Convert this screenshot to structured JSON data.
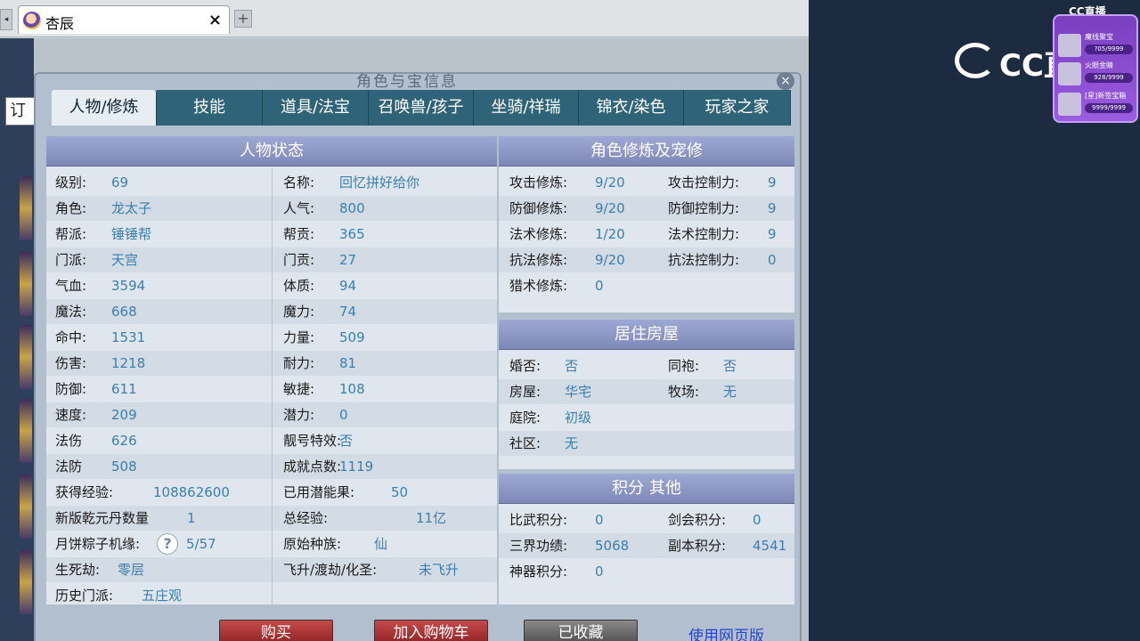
{
  "browser": {
    "tab_title": "杏辰",
    "tab_close": "×",
    "new_tab": "+",
    "page_left_box": "订",
    "scroll_left": "◂"
  },
  "dialog": {
    "title": "角色与宝信息",
    "close": "×",
    "tabs": [
      "人物/修炼",
      "技能",
      "道具/法宝",
      "召唤兽/孩子",
      "坐骑/祥瑞",
      "锦衣/染色",
      "玩家之家"
    ],
    "status": {
      "header": "人物状态",
      "left": [
        {
          "label": "级别:",
          "value": "69"
        },
        {
          "label": "角色:",
          "value": "龙太子"
        },
        {
          "label": "帮派:",
          "value": "锤锤帮"
        },
        {
          "label": "门派:",
          "value": "天宫"
        },
        {
          "label": "气血:",
          "value": "3594"
        },
        {
          "label": "魔法:",
          "value": "668"
        },
        {
          "label": "命中:",
          "value": "1531"
        },
        {
          "label": "伤害:",
          "value": "1218"
        },
        {
          "label": "防御:",
          "value": "611"
        },
        {
          "label": "速度:",
          "value": "209"
        },
        {
          "label": "法伤",
          "value": "626"
        },
        {
          "label": "法防",
          "value": "508"
        }
      ],
      "right": [
        {
          "label": "名称:",
          "value": "回忆拼好给你"
        },
        {
          "label": "人气:",
          "value": "800"
        },
        {
          "label": "帮贡:",
          "value": "365"
        },
        {
          "label": "门贡:",
          "value": "27"
        },
        {
          "label": "体质:",
          "value": "94"
        },
        {
          "label": "魔力:",
          "value": "74"
        },
        {
          "label": "力量:",
          "value": "509"
        },
        {
          "label": "耐力:",
          "value": "81"
        },
        {
          "label": "敏捷:",
          "value": "108"
        },
        {
          "label": "潜力:",
          "value": "0"
        },
        {
          "label": "靓号特效:",
          "value": "否"
        },
        {
          "label": "成就点数:",
          "value": "1119"
        }
      ],
      "extra": [
        {
          "label": "获得经验:",
          "value": "108862600",
          "label2": "已用潜能果:",
          "value2": "50"
        },
        {
          "label": "新版乾元丹数量",
          "value": "1",
          "label2": "总经验:",
          "value2": "11亿"
        },
        {
          "label": "月饼粽子机缘:",
          "value": "5/57",
          "label2": "原始种族:",
          "value2": "仙"
        },
        {
          "label": "生死劫:",
          "value": "零层",
          "label2": "飞升/渡劫/化圣:",
          "value2": "未飞升"
        },
        {
          "label": "历史门派:",
          "value": "五庄观",
          "label2": "",
          "value2": ""
        }
      ],
      "help": "?"
    },
    "cultivation": {
      "header": "角色修炼及宠修",
      "rows": [
        {
          "label": "攻击修炼:",
          "value": "9/20",
          "label2": "攻击控制力:",
          "value2": "9"
        },
        {
          "label": "防御修炼:",
          "value": "9/20",
          "label2": "防御控制力:",
          "value2": "9"
        },
        {
          "label": "法术修炼:",
          "value": "1/20",
          "label2": "法术控制力:",
          "value2": "9"
        },
        {
          "label": "抗法修炼:",
          "value": "9/20",
          "label2": "抗法控制力:",
          "value2": "0"
        },
        {
          "label": "猎术修炼:",
          "value": "0",
          "label2": "",
          "value2": ""
        }
      ]
    },
    "house": {
      "header": "居住房屋",
      "rows": [
        {
          "label": "婚否:",
          "value": "否",
          "label2": "同袍:",
          "value2": "否"
        },
        {
          "label": "房屋:",
          "value": "华宅",
          "label2": "牧场:",
          "value2": "无"
        },
        {
          "label": "庭院:",
          "value": "初级",
          "label2": "",
          "value2": ""
        },
        {
          "label": "社区:",
          "value": "无",
          "label2": "",
          "value2": ""
        }
      ]
    },
    "points": {
      "header": "积分 其他",
      "rows": [
        {
          "label": "比武积分:",
          "value": "0",
          "label2": "剑会积分:",
          "value2": "0"
        },
        {
          "label": "三界功绩:",
          "value": "5068",
          "label2": "副本积分:",
          "value2": "4541"
        },
        {
          "label": "神器积分:",
          "value": "0",
          "label2": "",
          "value2": ""
        }
      ]
    },
    "buttons": {
      "buy": "购买",
      "add_cart": "加入购物车",
      "collected": "已收藏",
      "web": "使用网页版"
    }
  },
  "overlay": {
    "brand": "CC直播",
    "top_logo": "CC直播",
    "gifts": [
      {
        "name": "魔线聚宝",
        "count": "?05/9999"
      },
      {
        "name": "火眼金睛",
        "count": "928/9999"
      },
      {
        "name": "[星]新签宝箱",
        "count": "9999/9999"
      }
    ]
  }
}
